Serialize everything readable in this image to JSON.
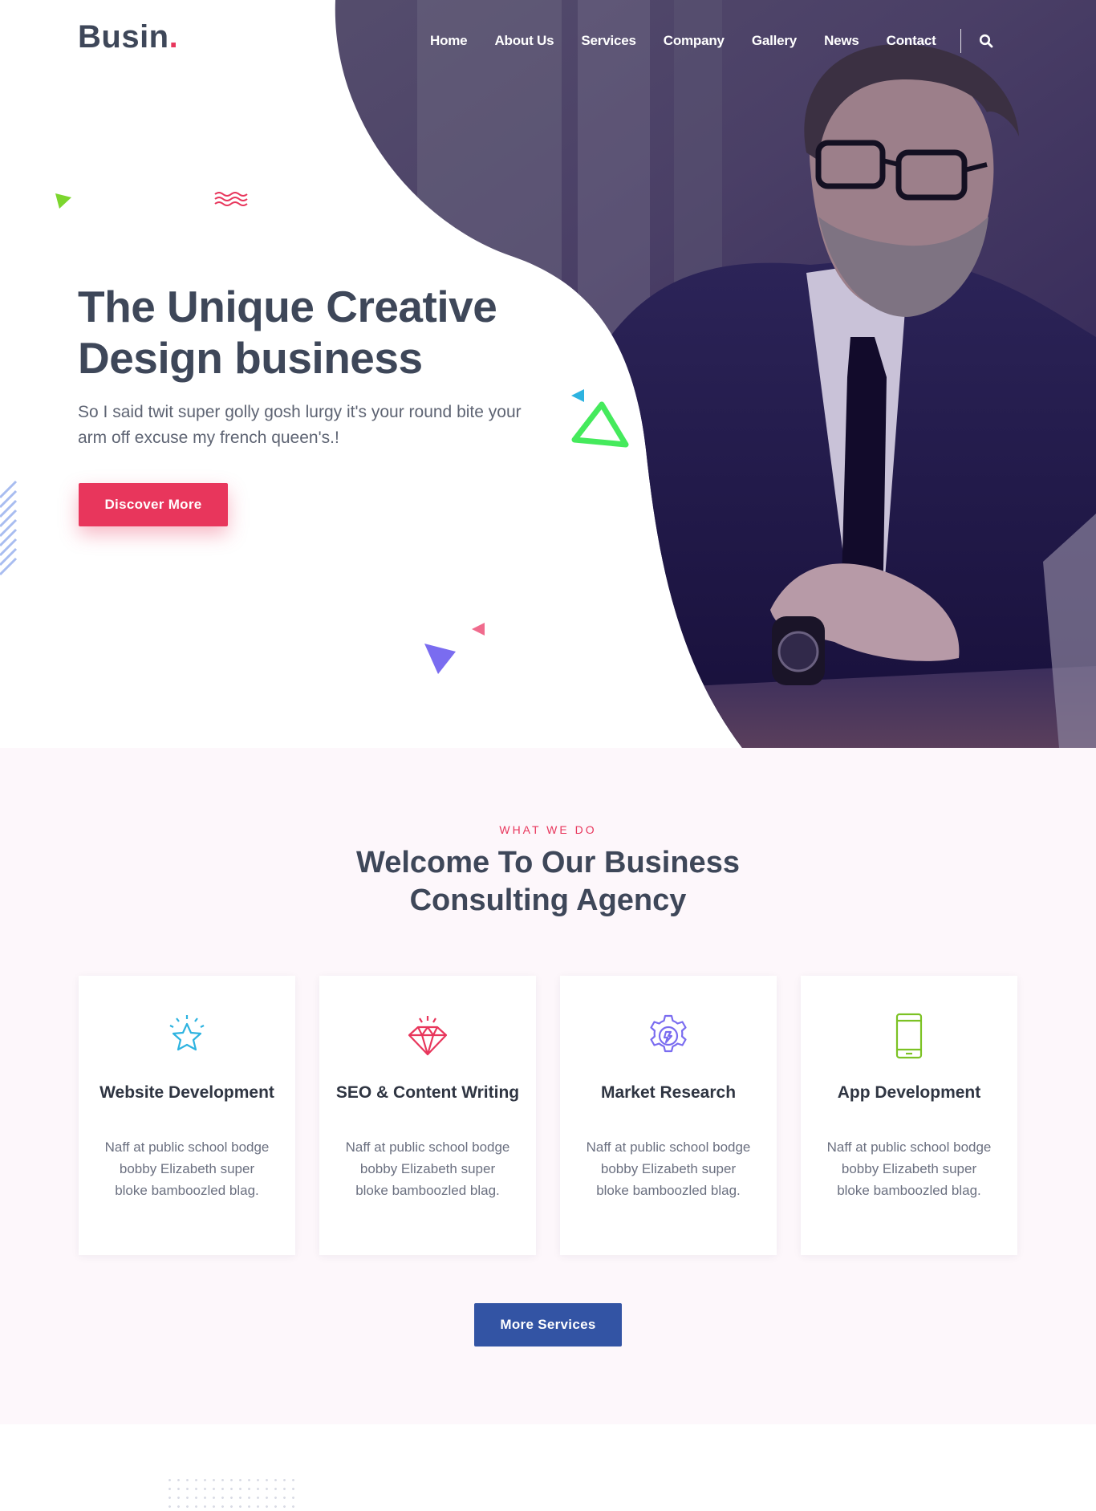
{
  "header": {
    "logo_text": "Busin",
    "logo_dot": ".",
    "nav": [
      "Home",
      "About Us",
      "Services",
      "Company",
      "Gallery",
      "News",
      "Contact"
    ],
    "search_icon": "search-icon"
  },
  "hero": {
    "title": "The Unique Creative Design business",
    "text": "So I said twit super golly gosh lurgy it's your round bite your arm off excuse my french queen's.!",
    "button_label": "Discover More"
  },
  "services": {
    "eyebrow": "WHAT WE DO",
    "title": "Welcome To Our Business Consulting Agency",
    "cards": [
      {
        "icon": "star-icon",
        "title": "Website Development",
        "text": "Naff at public school bodge bobby Elizabeth super bloke bamboozled blag.",
        "color": "#2db3e0"
      },
      {
        "icon": "diamond-icon",
        "title": "SEO & Content Writing",
        "text": "Naff at public school bodge bobby Elizabeth super bloke bamboozled blag.",
        "color": "#e8365c"
      },
      {
        "icon": "gear-icon",
        "title": "Market Research",
        "text": "Naff at public school bodge bobby Elizabeth super bloke bamboozled blag.",
        "color": "#7a6cf0"
      },
      {
        "icon": "smartphone-icon",
        "title": "App Development",
        "text": "Naff at public school bodge bobby Elizabeth super bloke bamboozled blag.",
        "color": "#7cc224"
      }
    ],
    "button_label": "More Services"
  },
  "colors": {
    "primary_text": "#3e4759",
    "accent_pink": "#e8365c",
    "accent_blue": "#3354a4",
    "photo_overlay": "#3a2a6b",
    "services_bg": "#fdf7fb"
  }
}
